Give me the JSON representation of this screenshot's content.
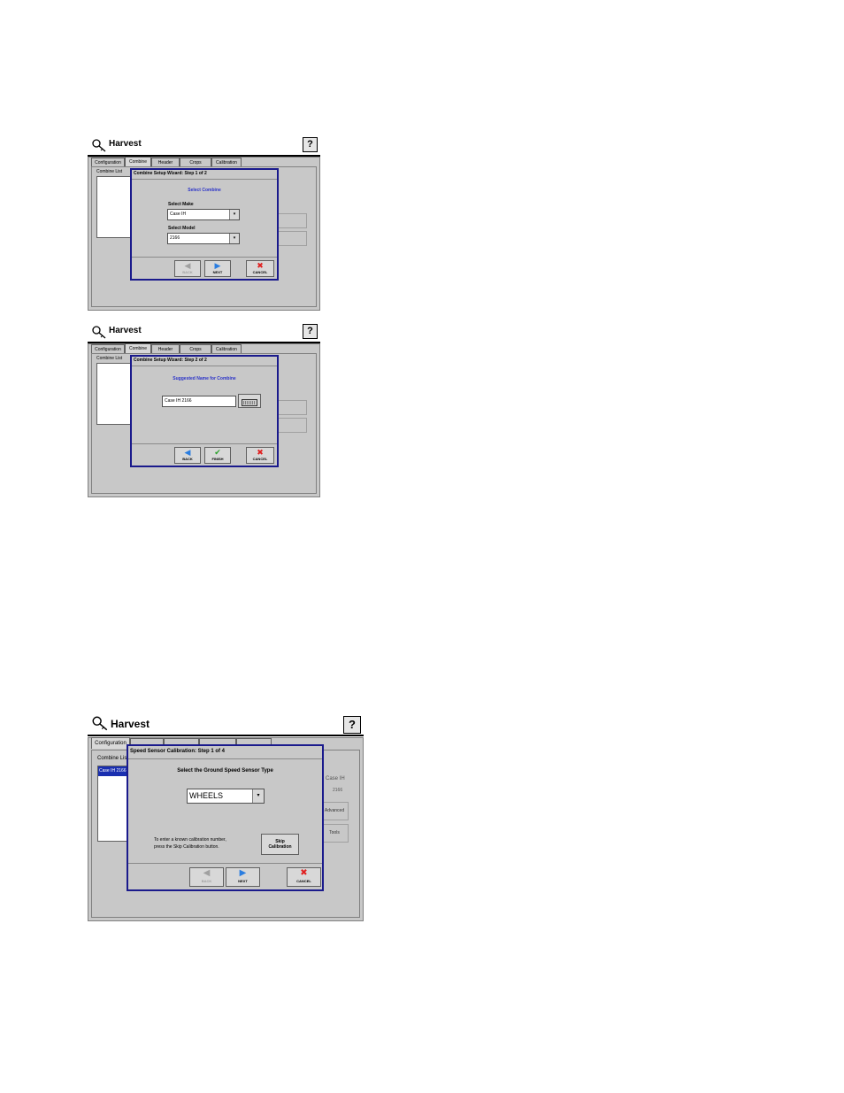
{
  "app": {
    "title": "Harvest",
    "help_label": "?"
  },
  "tabs": [
    "Configuration",
    "Combine",
    "Header",
    "Crops",
    "Calibration"
  ],
  "combine_list_label": "Combine List",
  "wizard1": {
    "title": "Combine Setup Wizard:  Step 1 of 2",
    "heading": "Select Combine",
    "make_label": "Select Make",
    "make_value": "Case IH",
    "model_label": "Select Model",
    "model_value": "2166",
    "back": "BACK",
    "next": "NEXT",
    "cancel": "CANCEL"
  },
  "wizard2": {
    "title": "Combine Setup Wizard:  Step 2 of 2",
    "heading": "Suggested Name for Combine",
    "name_value": "Case IH 2166",
    "back": "BACK",
    "finish": "FINISH",
    "cancel": "CANCEL"
  },
  "wizard3": {
    "title": "Speed Sensor Calibration:  Step 1 of 4",
    "heading": "Select the Ground Speed Sensor Type",
    "sensor_value": "WHEELS",
    "hint_line1": "To enter a known calibration number,",
    "hint_line2": "press the Skip Calibration button.",
    "skip_line1": "Skip",
    "skip_line2": "Calibration",
    "back": "BACK",
    "next": "NEXT",
    "cancel": "CANCEL"
  },
  "screen3": {
    "list_item": "Case IH 2166",
    "combine_list_label": "Combine List",
    "make": "Case IH",
    "model": "2166",
    "btn1": "Advanced",
    "btn2": "Tools"
  }
}
